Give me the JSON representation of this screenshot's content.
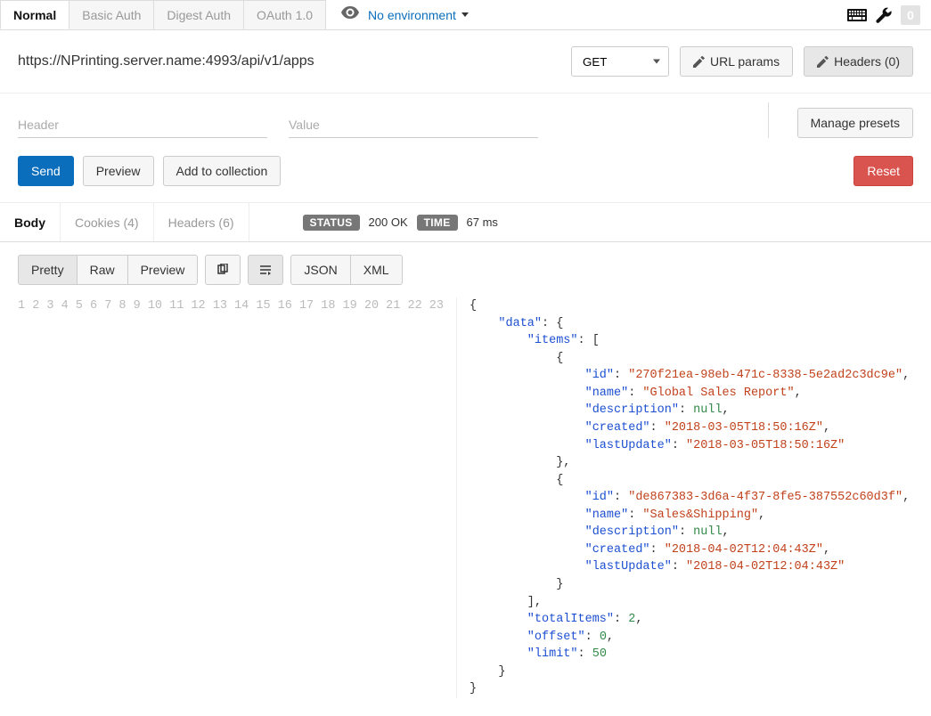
{
  "topTabs": [
    {
      "label": "Normal",
      "active": true
    },
    {
      "label": "Basic Auth",
      "active": false
    },
    {
      "label": "Digest Auth",
      "active": false
    },
    {
      "label": "OAuth 1.0",
      "active": false
    }
  ],
  "environment": {
    "label": "No environment"
  },
  "topRight": {
    "badge": "0"
  },
  "request": {
    "url": "https://NPrinting.server.name:4993/api/v1/apps",
    "method": "GET",
    "urlParamsLabel": "URL params",
    "headersLabel": "Headers (0)"
  },
  "kvPlaceholders": {
    "header": "Header",
    "value": "Value"
  },
  "managePresetsLabel": "Manage presets",
  "actions": {
    "send": "Send",
    "preview": "Preview",
    "addToCollection": "Add to collection",
    "reset": "Reset"
  },
  "responseTabs": {
    "body": "Body",
    "cookies": "Cookies (4)",
    "headers": "Headers (6)"
  },
  "status": {
    "statusLabel": "STATUS",
    "statusValue": "200 OK",
    "timeLabel": "TIME",
    "timeValue": "67 ms"
  },
  "viewModes": {
    "pretty": "Pretty",
    "raw": "Raw",
    "preview": "Preview",
    "json": "JSON",
    "xml": "XML"
  },
  "codeLines": [
    [
      {
        "t": "p",
        "v": "{"
      }
    ],
    [
      {
        "t": "p",
        "v": "    "
      },
      {
        "t": "k",
        "v": "\"data\""
      },
      {
        "t": "p",
        "v": ": {"
      }
    ],
    [
      {
        "t": "p",
        "v": "        "
      },
      {
        "t": "k",
        "v": "\"items\""
      },
      {
        "t": "p",
        "v": ": ["
      }
    ],
    [
      {
        "t": "p",
        "v": "            {"
      }
    ],
    [
      {
        "t": "p",
        "v": "                "
      },
      {
        "t": "k",
        "v": "\"id\""
      },
      {
        "t": "p",
        "v": ": "
      },
      {
        "t": "s",
        "v": "\"270f21ea-98eb-471c-8338-5e2ad2c3dc9e\""
      },
      {
        "t": "p",
        "v": ","
      }
    ],
    [
      {
        "t": "p",
        "v": "                "
      },
      {
        "t": "k",
        "v": "\"name\""
      },
      {
        "t": "p",
        "v": ": "
      },
      {
        "t": "s",
        "v": "\"Global Sales Report\""
      },
      {
        "t": "p",
        "v": ","
      }
    ],
    [
      {
        "t": "p",
        "v": "                "
      },
      {
        "t": "k",
        "v": "\"description\""
      },
      {
        "t": "p",
        "v": ": "
      },
      {
        "t": "n",
        "v": "null"
      },
      {
        "t": "p",
        "v": ","
      }
    ],
    [
      {
        "t": "p",
        "v": "                "
      },
      {
        "t": "k",
        "v": "\"created\""
      },
      {
        "t": "p",
        "v": ": "
      },
      {
        "t": "s",
        "v": "\"2018-03-05T18:50:16Z\""
      },
      {
        "t": "p",
        "v": ","
      }
    ],
    [
      {
        "t": "p",
        "v": "                "
      },
      {
        "t": "k",
        "v": "\"lastUpdate\""
      },
      {
        "t": "p",
        "v": ": "
      },
      {
        "t": "s",
        "v": "\"2018-03-05T18:50:16Z\""
      }
    ],
    [
      {
        "t": "p",
        "v": "            },"
      }
    ],
    [
      {
        "t": "p",
        "v": "            {"
      }
    ],
    [
      {
        "t": "p",
        "v": "                "
      },
      {
        "t": "k",
        "v": "\"id\""
      },
      {
        "t": "p",
        "v": ": "
      },
      {
        "t": "s",
        "v": "\"de867383-3d6a-4f37-8fe5-387552c60d3f\""
      },
      {
        "t": "p",
        "v": ","
      }
    ],
    [
      {
        "t": "p",
        "v": "                "
      },
      {
        "t": "k",
        "v": "\"name\""
      },
      {
        "t": "p",
        "v": ": "
      },
      {
        "t": "s",
        "v": "\"Sales&Shipping\""
      },
      {
        "t": "p",
        "v": ","
      }
    ],
    [
      {
        "t": "p",
        "v": "                "
      },
      {
        "t": "k",
        "v": "\"description\""
      },
      {
        "t": "p",
        "v": ": "
      },
      {
        "t": "n",
        "v": "null"
      },
      {
        "t": "p",
        "v": ","
      }
    ],
    [
      {
        "t": "p",
        "v": "                "
      },
      {
        "t": "k",
        "v": "\"created\""
      },
      {
        "t": "p",
        "v": ": "
      },
      {
        "t": "s",
        "v": "\"2018-04-02T12:04:43Z\""
      },
      {
        "t": "p",
        "v": ","
      }
    ],
    [
      {
        "t": "p",
        "v": "                "
      },
      {
        "t": "k",
        "v": "\"lastUpdate\""
      },
      {
        "t": "p",
        "v": ": "
      },
      {
        "t": "s",
        "v": "\"2018-04-02T12:04:43Z\""
      }
    ],
    [
      {
        "t": "p",
        "v": "            }"
      }
    ],
    [
      {
        "t": "p",
        "v": "        ],"
      }
    ],
    [
      {
        "t": "p",
        "v": "        "
      },
      {
        "t": "k",
        "v": "\"totalItems\""
      },
      {
        "t": "p",
        "v": ": "
      },
      {
        "t": "n",
        "v": "2"
      },
      {
        "t": "p",
        "v": ","
      }
    ],
    [
      {
        "t": "p",
        "v": "        "
      },
      {
        "t": "k",
        "v": "\"offset\""
      },
      {
        "t": "p",
        "v": ": "
      },
      {
        "t": "n",
        "v": "0"
      },
      {
        "t": "p",
        "v": ","
      }
    ],
    [
      {
        "t": "p",
        "v": "        "
      },
      {
        "t": "k",
        "v": "\"limit\""
      },
      {
        "t": "p",
        "v": ": "
      },
      {
        "t": "n",
        "v": "50"
      }
    ],
    [
      {
        "t": "p",
        "v": "    }"
      }
    ],
    [
      {
        "t": "p",
        "v": "}"
      }
    ]
  ]
}
